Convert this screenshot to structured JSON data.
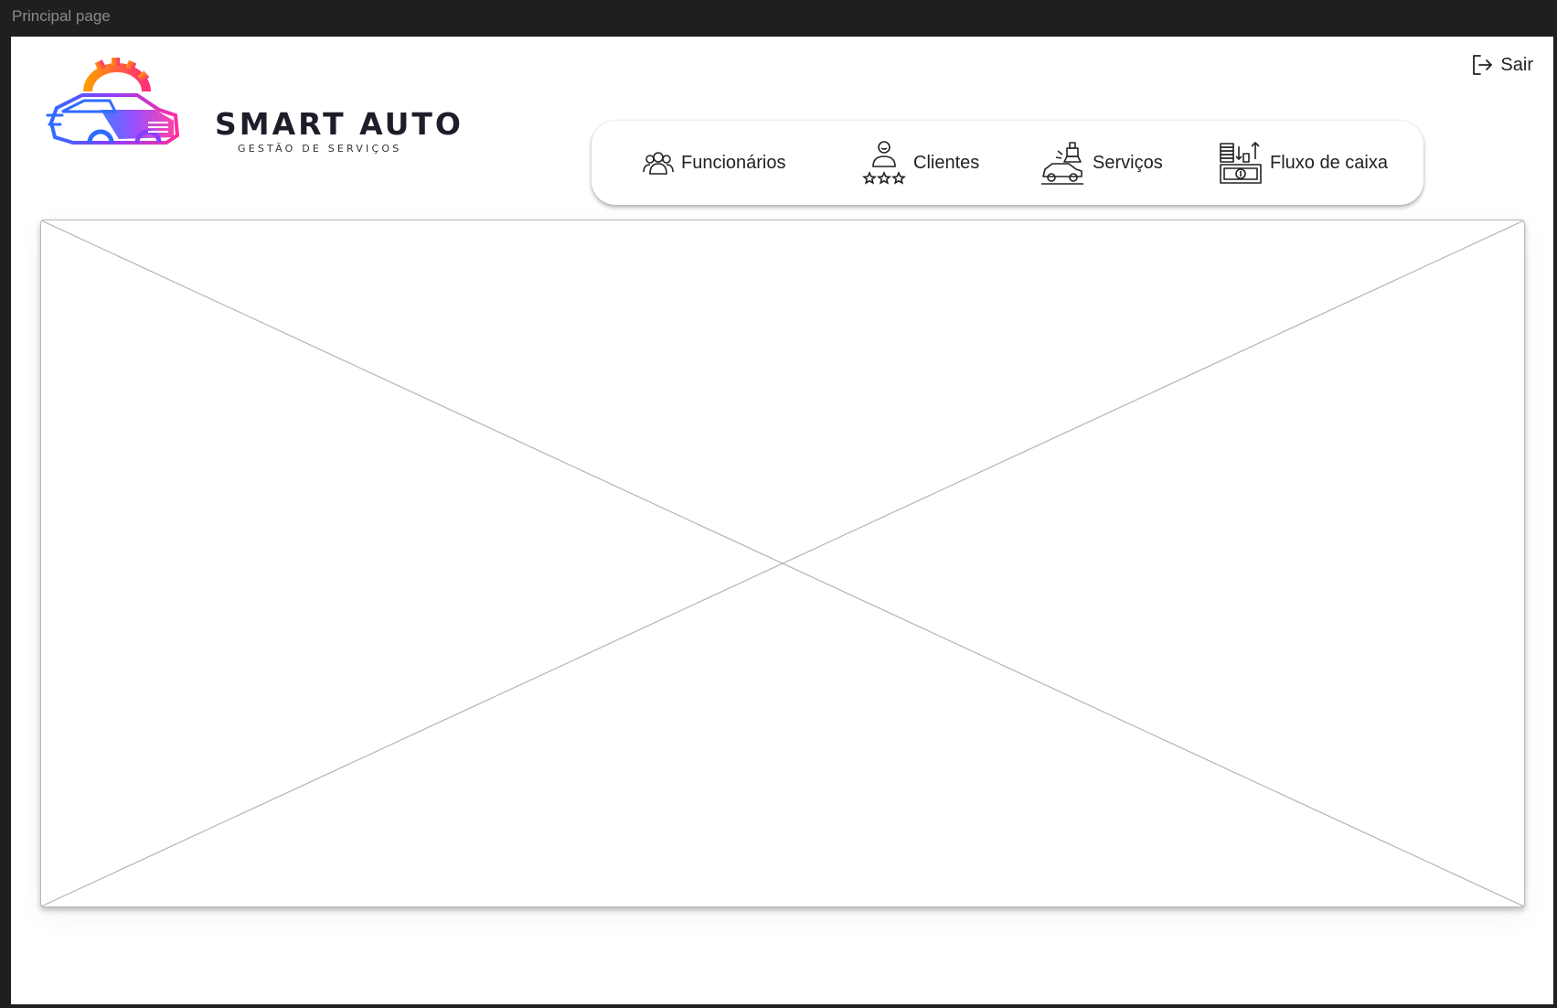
{
  "frame": {
    "label": "Principal page"
  },
  "brand": {
    "name": "SMART AUTO",
    "tagline": "GESTÃO DE SERVIÇOS"
  },
  "header": {
    "logout_label": "Sair",
    "logout_icon": "logout-icon"
  },
  "nav": {
    "items": [
      {
        "label": "Funcionários",
        "icon": "employees-icon"
      },
      {
        "label": "Clientes",
        "icon": "client-rating-icon"
      },
      {
        "label": "Serviços",
        "icon": "car-service-icon"
      },
      {
        "label": "Fluxo de caixa",
        "icon": "cash-flow-icon"
      }
    ]
  },
  "colors": {
    "frame_background": "#1f1f1f",
    "page_background": "#ffffff",
    "brand_text": "#1e1e2a",
    "logo_gradient": [
      "#ff8a00",
      "#ff2d7a",
      "#8a3dff",
      "#2f6bff"
    ]
  }
}
